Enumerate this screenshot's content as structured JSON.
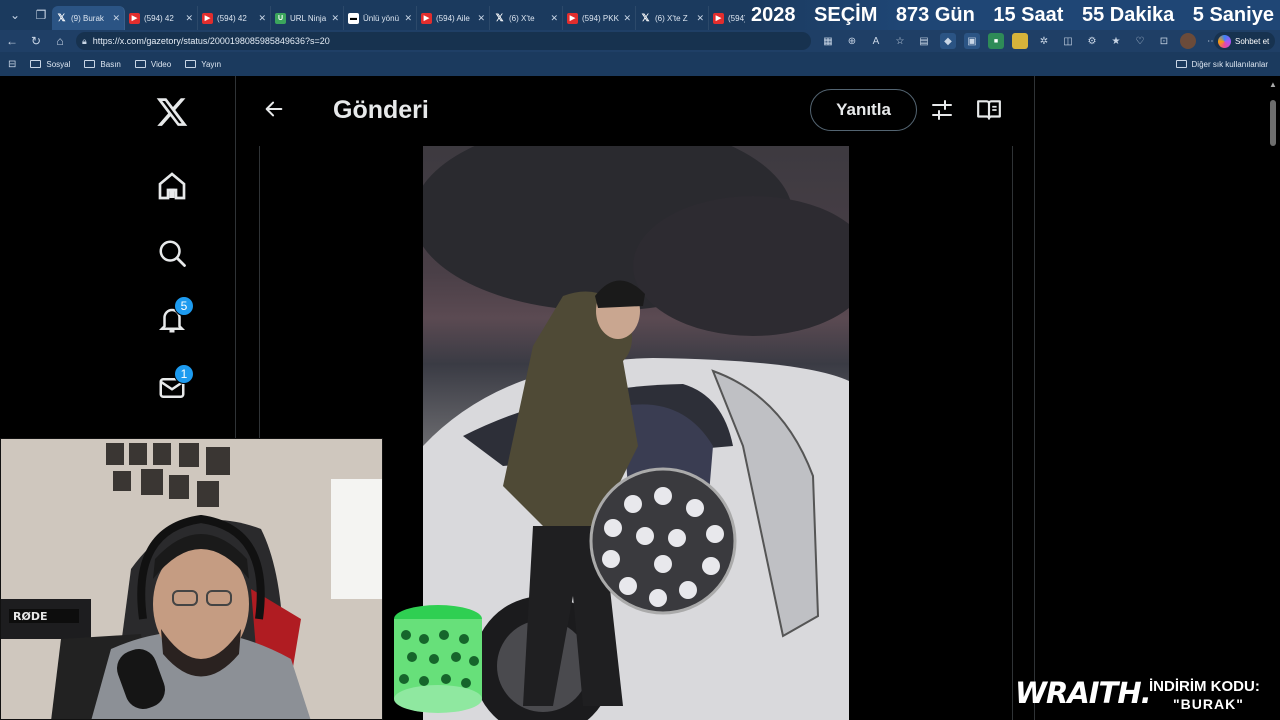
{
  "browser": {
    "tabs": [
      {
        "title": "(9) Burak",
        "favicon": "x"
      },
      {
        "title": "(594) 42",
        "favicon": "youtube"
      },
      {
        "title": "(594) 42",
        "favicon": "youtube"
      },
      {
        "title": "URL Ninja",
        "favicon": "url"
      },
      {
        "title": "Ünlü yönü",
        "favicon": "doc"
      },
      {
        "title": "(594) Aile",
        "favicon": "youtube"
      },
      {
        "title": "(6) X'te",
        "favicon": "x"
      },
      {
        "title": "(594) PKK",
        "favicon": "youtube"
      },
      {
        "title": "(6) X'te Z",
        "favicon": "x"
      },
      {
        "title": "(594)",
        "favicon": "youtube"
      }
    ],
    "url": "https://x.com/gazetory/status/2000198085985849636?s=20",
    "copilot_label": "Sohbet et",
    "bookmarks": [
      "Sosyal",
      "Basın",
      "Video",
      "Yayın"
    ],
    "bookmarks_other": "Diğer sık kullanılanlar"
  },
  "countdown": {
    "year": "2028",
    "label": "SEÇİM",
    "days": "873 Gün",
    "hours": "15 Saat",
    "minutes": "55 Dakika",
    "seconds": "5 Saniye"
  },
  "sidebar": {
    "icons": [
      "x-logo-icon",
      "home-icon",
      "search-icon",
      "bell-icon",
      "mail-icon"
    ],
    "notifications_badge": "5",
    "messages_badge": "1"
  },
  "header": {
    "title": "Gönderi",
    "reply_label": "Yanıtla"
  },
  "overlay": {
    "brand": "WRAITH.",
    "promo_label": "İNDİRİM KODU:",
    "promo_code": "\"BURAK\""
  },
  "colors": {
    "accent": "#1d9bf0",
    "browser_chrome": "#1b3a5e",
    "background": "#000000"
  }
}
